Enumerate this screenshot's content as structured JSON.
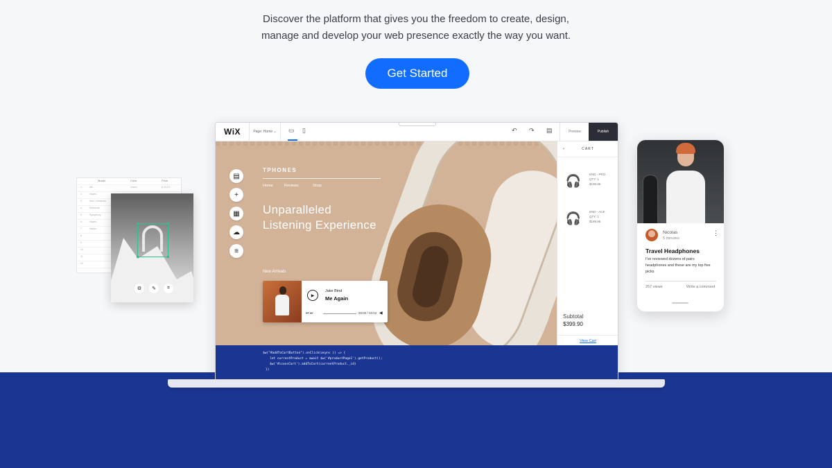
{
  "hero": {
    "line1": "Discover the platform that gives you the freedom to create, design,",
    "line2": "manage and develop your web presence exactly the way you want.",
    "cta_label": "Get Started"
  },
  "colors": {
    "accent": "#116dff",
    "band": "#1b3593",
    "canvas": "#d2b398"
  },
  "editor": {
    "logo": "WiX",
    "page_select": "Page: Home ⌄",
    "preview_label": "Preview",
    "publish_label": "Publish",
    "site": {
      "brand": "TPHONES",
      "nav": [
        "Home",
        "Reviews",
        "Shop"
      ],
      "headline_1": "Unparalleled",
      "headline_2": "Listening Experience",
      "arrivals_label": "New Arrivals",
      "player": {
        "artist": "Jake Bind",
        "track": "Me Again",
        "time": "00:00 / 03:04"
      }
    },
    "cart": {
      "title": "CART",
      "items": [
        {
          "name": "END - PRO",
          "qty": "QTY: 1",
          "price": "$199.95"
        },
        {
          "name": "END - ACE",
          "qty": "QTY: 1",
          "price": "$199.95"
        }
      ],
      "subtotal_label": "Subtotal",
      "subtotal_value": "$399.90",
      "view_cart": "View Cart"
    },
    "code_lines": [
      "$w(\"#addToCartButton\").onClick(async () => {",
      "let currentProduct = await $w('#productPage1').getProduct();",
      "$w('#iconsCart').addToCart(currentProduct._id)",
      "})"
    ]
  },
  "sheet": {
    "headers": [
      "Model",
      "Color",
      "Price"
    ],
    "rows": [
      [
        "1",
        "A5",
        "Green",
        "$ 43.19"
      ],
      [
        "2",
        "Hades",
        "",
        ""
      ],
      [
        "3",
        "Aero Christmas",
        "",
        ""
      ],
      [
        "4",
        "Elements",
        "",
        ""
      ],
      [
        "5",
        "Symphony",
        "",
        ""
      ],
      [
        "6",
        "Hades",
        "",
        ""
      ],
      [
        "7",
        "Hades",
        "",
        ""
      ],
      [
        "8",
        "",
        "",
        ""
      ],
      [
        "9",
        "",
        "",
        ""
      ],
      [
        "10",
        "",
        "",
        ""
      ],
      [
        "11",
        "",
        "",
        ""
      ],
      [
        "12",
        "",
        "",
        ""
      ]
    ]
  },
  "phone": {
    "author": "Nicolas",
    "time": "5 minutes",
    "title": "Travel Headphones",
    "excerpt": "I've reviewed dozens of pairs headphones and these are my top five picks",
    "views": "257 views",
    "comment": "Write a comment"
  }
}
